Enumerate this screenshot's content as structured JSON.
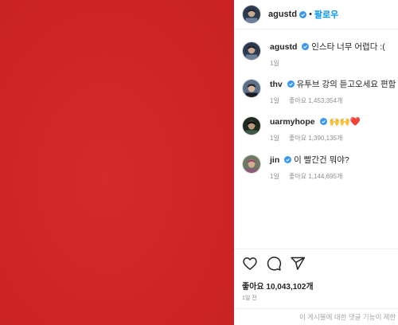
{
  "post": {
    "image_color": "#cf2627"
  },
  "header": {
    "username": "agustd",
    "separator": "•",
    "follow_label": "팔로우"
  },
  "comments": [
    {
      "username": "agustd",
      "text": "인스타 너무 어렵다 :(",
      "time": "1일",
      "likes": ""
    },
    {
      "username": "thv",
      "text": "유투브 강의 듣고오세요 편함 👏",
      "time": "1일",
      "likes": "좋아요 1,453,354개"
    },
    {
      "username": "uarmyhope",
      "text": "🙌🙌❤️",
      "time": "1일",
      "likes": "좋아요 1,390,135개"
    },
    {
      "username": "jin",
      "text": "이 빨간건 뭐야?",
      "time": "1일",
      "likes": "좋아요 1,144,695개"
    }
  ],
  "footer": {
    "likes": "좋아요 10,043,102개",
    "time": "1일 전",
    "comments_disabled": "이 게시물에 대한 댓글 기능이 제한"
  },
  "colors": {
    "link_blue": "#0095f6",
    "verified_blue": "#3897f0",
    "muted_gray": "#8e8e8e"
  }
}
